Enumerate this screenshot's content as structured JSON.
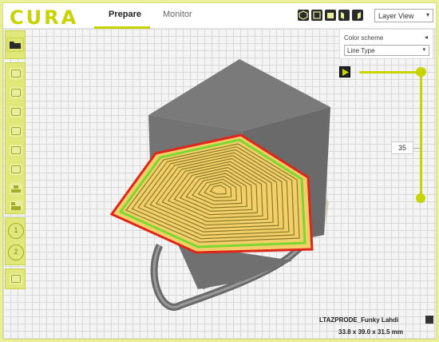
{
  "app": {
    "logo": "CURA"
  },
  "tabs": {
    "prepare": "Prepare",
    "monitor": "Monitor"
  },
  "view_buttons": [
    "3d-view-icon",
    "front-view-icon",
    "top-view-icon",
    "left-view-icon",
    "right-view-icon"
  ],
  "view_mode": {
    "selected": "Layer View"
  },
  "layer_panel": {
    "title": "Color scheme",
    "scheme": "Line Type"
  },
  "layer_slider": {
    "current_layer": "35"
  },
  "sidebar": {
    "buttons": [
      "open-file-icon",
      "translate-icon",
      "scale-icon",
      "rotate-icon",
      "mirror-icon",
      "per-model-settings-icon",
      "support-blocker-icon",
      "extruder-icon"
    ],
    "extruders": [
      "1",
      "2"
    ]
  },
  "model": {
    "name": "LTAZPRODE_Funky Lahdi",
    "dimensions": "33.8 x 39.0 x 31.5 mm"
  },
  "colors": {
    "accent": "#c8d400",
    "model": "#7a7a7a",
    "wall_outer": "#e0261b",
    "wall_inner": "#7cd830",
    "infill": "#f0c85a"
  }
}
